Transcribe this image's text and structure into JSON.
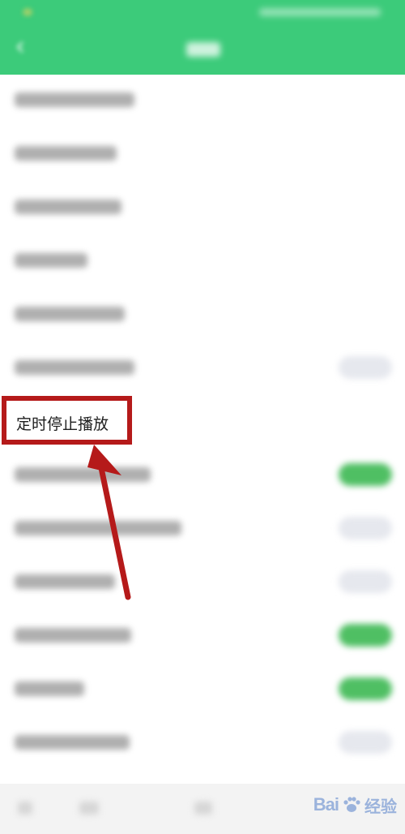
{
  "highlight": {
    "label": "定时停止播放"
  },
  "watermark": {
    "brand_left": "Bai",
    "brand_right": "经验"
  },
  "colors": {
    "header_green": "#3ccb7a",
    "toggle_on": "#4fbf63",
    "toggle_off": "#e6e8ee",
    "annotation_red": "#b51a1a",
    "watermark_blue": "#9bb3dc"
  },
  "toggles": [
    {
      "row": "row-6",
      "state": "off"
    },
    {
      "row": "row-8",
      "state": "on"
    },
    {
      "row": "row-9",
      "state": "off"
    },
    {
      "row": "row-10",
      "state": "off"
    },
    {
      "row": "row-11",
      "state": "on"
    },
    {
      "row": "row-12",
      "state": "on"
    },
    {
      "row": "row-13",
      "state": "off"
    }
  ],
  "icons": {
    "back": "back-arrow-icon",
    "annotation": "annotation-arrow-icon",
    "watermark": "baidu-paw-icon"
  }
}
